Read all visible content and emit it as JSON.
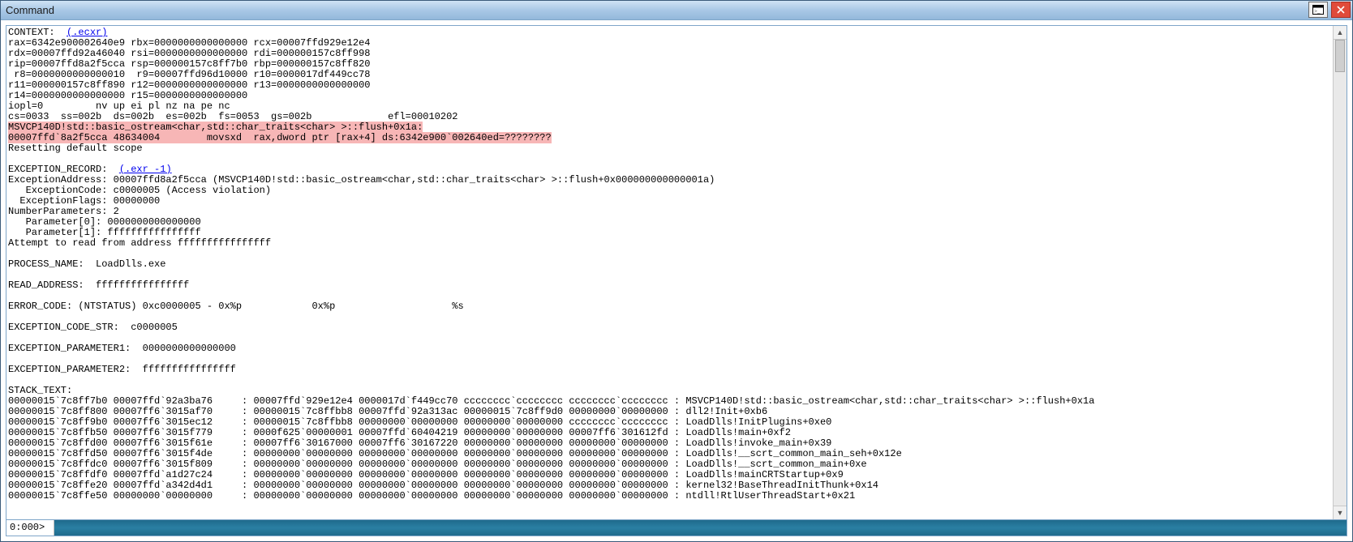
{
  "window": {
    "title": "Command"
  },
  "links": {
    "ecxr": "(.ecxr)",
    "exr": "(.exr -1)"
  },
  "context": {
    "header": "CONTEXT:  ",
    "regs": [
      "rax=6342e900002640e9 rbx=0000000000000000 rcx=00007ffd929e12e4",
      "rdx=00007ffd92a46040 rsi=0000000000000000 rdi=000000157c8ff998",
      "rip=00007ffd8a2f5cca rsp=000000157c8ff7b0 rbp=000000157c8ff820",
      " r8=0000000000000010  r9=00007ffd96d10000 r10=0000017df449cc78",
      "r11=000000157c8ff890 r12=0000000000000000 r13=0000000000000000",
      "r14=0000000000000000 r15=0000000000000000",
      "iopl=0         nv up ei pl nz na pe nc",
      "cs=0033  ss=002b  ds=002b  es=002b  fs=0053  gs=002b             efl=00010202"
    ],
    "hl1": "MSVCP140D!std::basic_ostream<char,std::char_traits<char> >::flush+0x1a:",
    "hl2": "00007ffd`8a2f5cca 48634004        movsxd  rax,dword ptr [rax+4] ds:6342e900`002640ed=????????",
    "reset": "Resetting default scope"
  },
  "exception": {
    "header": "EXCEPTION_RECORD:  ",
    "lines": [
      "ExceptionAddress: 00007ffd8a2f5cca (MSVCP140D!std::basic_ostream<char,std::char_traits<char> >::flush+0x000000000000001a)",
      "   ExceptionCode: c0000005 (Access violation)",
      "  ExceptionFlags: 00000000",
      "NumberParameters: 2",
      "   Parameter[0]: 0000000000000000",
      "   Parameter[1]: ffffffffffffffff",
      "Attempt to read from address ffffffffffffffff"
    ]
  },
  "fields": {
    "process_name": "PROCESS_NAME:  LoadDlls.exe",
    "read_address": "READ_ADDRESS:  ffffffffffffffff ",
    "error_code": "ERROR_CODE: (NTSTATUS) 0xc0000005 - 0x%p            0x%p                    %s",
    "exc_code_str": "EXCEPTION_CODE_STR:  c0000005",
    "exc_param1": "EXCEPTION_PARAMETER1:  0000000000000000",
    "exc_param2": "EXCEPTION_PARAMETER2:  ffffffffffffffff"
  },
  "stack": {
    "header": "STACK_TEXT:  ",
    "rows": [
      "00000015`7c8ff7b0 00007ffd`92a3ba76     : 00007ffd`929e12e4 0000017d`f449cc70 cccccccc`cccccccc cccccccc`cccccccc : MSVCP140D!std::basic_ostream<char,std::char_traits<char> >::flush+0x1a",
      "00000015`7c8ff800 00007ff6`3015af70     : 00000015`7c8ffbb8 00007ffd`92a313ac 00000015`7c8ff9d0 00000000`00000000 : dll2!Init+0xb6",
      "00000015`7c8ff9b0 00007ff6`3015ec12     : 00000015`7c8ffbb8 00000000`00000000 00000000`00000000 cccccccc`cccccccc : LoadDlls!InitPlugins+0xe0",
      "00000015`7c8ffb50 00007ff6`3015f779     : 0000f625`00000001 00007ffd`60404219 00000000`00000000 00007ff6`301612fd : LoadDlls!main+0xf2",
      "00000015`7c8ffd00 00007ff6`3015f61e     : 00007ff6`30167000 00007ff6`30167220 00000000`00000000 00000000`00000000 : LoadDlls!invoke_main+0x39",
      "00000015`7c8ffd50 00007ff6`3015f4de     : 00000000`00000000 00000000`00000000 00000000`00000000 00000000`00000000 : LoadDlls!__scrt_common_main_seh+0x12e",
      "00000015`7c8ffdc0 00007ff6`3015f809     : 00000000`00000000 00000000`00000000 00000000`00000000 00000000`00000000 : LoadDlls!__scrt_common_main+0xe",
      "00000015`7c8ffdf0 00007ffd`a1d27c24     : 00000000`00000000 00000000`00000000 00000000`00000000 00000000`00000000 : LoadDlls!mainCRTStartup+0x9",
      "00000015`7c8ffe20 00007ffd`a342d4d1     : 00000000`00000000 00000000`00000000 00000000`00000000 00000000`00000000 : kernel32!BaseThreadInitThunk+0x14",
      "00000015`7c8ffe50 00000000`00000000     : 00000000`00000000 00000000`00000000 00000000`00000000 00000000`00000000 : ntdll!RtlUserThreadStart+0x21"
    ]
  },
  "prompt": {
    "label": "0:000> ",
    "value": ""
  }
}
